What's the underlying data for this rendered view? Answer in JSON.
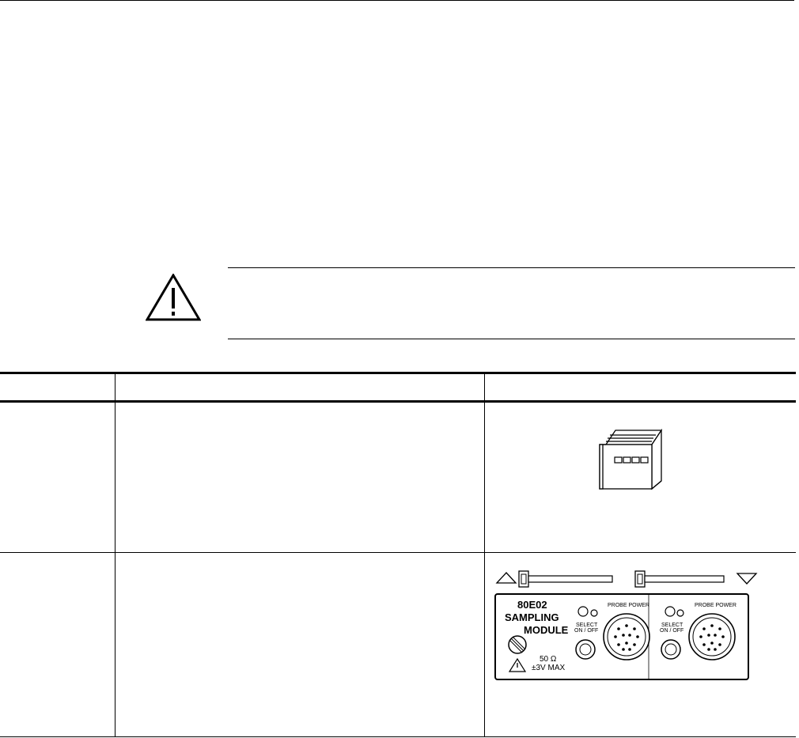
{
  "page": {
    "warning": {
      "icon": "warning-triangle-icon",
      "text": ""
    }
  },
  "table": {
    "headers": [
      "",
      "",
      ""
    ],
    "rows": [
      {
        "col1": "",
        "col2": "",
        "figure_icon": "manual-book-icon"
      },
      {
        "col1": "",
        "col2": "",
        "figure_icon": "sampling-module-front-panel"
      }
    ]
  },
  "module_panel": {
    "model": "80E02",
    "line1": "SAMPLING",
    "line2": "MODULE",
    "select_label_1": "SELECT",
    "select_label_2": "ON / OFF",
    "probe_power_label": "PROBE POWER",
    "impedance": "50 Ω",
    "max_voltage": "±3V MAX"
  }
}
